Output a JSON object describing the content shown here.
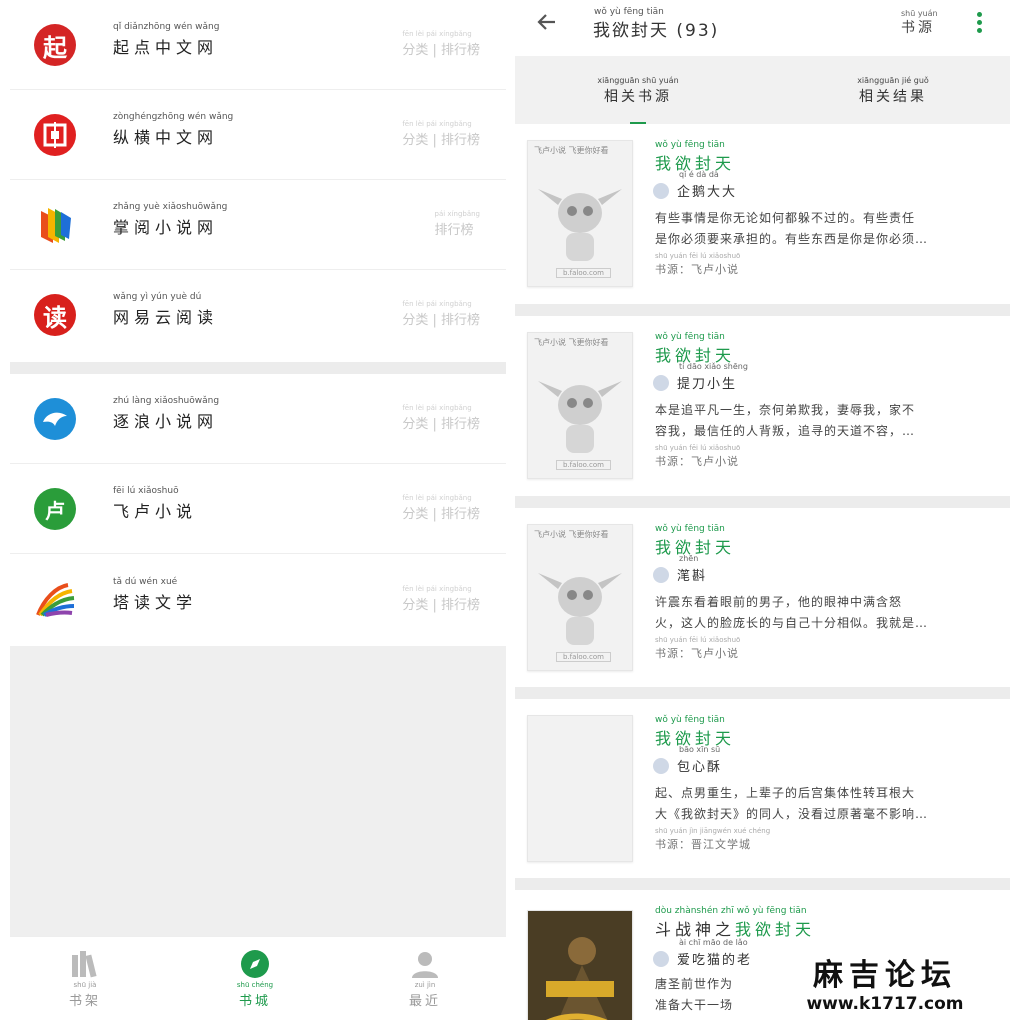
{
  "left_panel": {
    "sources": [
      {
        "pinyin": "qǐ diǎnzhōng wén wǎng",
        "name": "起点中文网",
        "actions_pinyin": "fēn lèi   pái xíngbǎng",
        "actions": "分类 | 排行榜",
        "logo_color": "#d42525",
        "logo_char": "起",
        "icon": "qidian-logo-icon"
      },
      {
        "pinyin": "zònghéngzhōng wén wǎng",
        "name": "纵横中文网",
        "actions_pinyin": "fēn lèi   pái xíngbǎng",
        "actions": "分类 | 排行榜",
        "logo_color": "#e02020",
        "logo_char": "回",
        "icon": "zongheng-logo-icon"
      },
      {
        "pinyin": "zhǎng yuè xiǎoshuōwǎng",
        "name": "掌阅小说网",
        "actions_pinyin": "pái xíngbǎng",
        "actions": "排行榜",
        "logo_color": "#f29a1d",
        "logo_char": "",
        "icon": "zhangyue-logo-icon"
      },
      {
        "pinyin": "wǎng yì yún yuè dú",
        "name": "网易云阅读",
        "actions_pinyin": "fēn lèi   pái xíngbǎng",
        "actions": "分类 | 排行榜",
        "logo_color": "#d8201c",
        "logo_char": "读",
        "icon": "netease-read-logo-icon"
      },
      {
        "pinyin": "zhú làng xiǎoshuōwǎng",
        "name": "逐浪小说网",
        "actions_pinyin": "fēn lèi   pái xíngbǎng",
        "actions": "分类 | 排行榜",
        "logo_color": "#1e8fd8",
        "logo_char": "",
        "icon": "zhulang-dolphin-icon"
      },
      {
        "pinyin": "fēi  lú  xiǎoshuō",
        "name": "飞卢小说",
        "actions_pinyin": "fēn lèi   pái xíngbǎng",
        "actions": "分类 | 排行榜",
        "logo_color": "#2a9d3a",
        "logo_char": "卢",
        "icon": "faloo-logo-icon"
      },
      {
        "pinyin": "tǎ  dú  wén xué",
        "name": "塔读文学",
        "actions_pinyin": "fēn lèi   pái xíngbǎng",
        "actions": "分类 | 排行榜",
        "logo_color": "#f5a623",
        "logo_char": "",
        "icon": "tadu-logo-icon"
      }
    ],
    "nav": [
      {
        "pinyin": "shū jià",
        "label": "书架",
        "icon": "bookshelf-icon"
      },
      {
        "pinyin": "shū chéng",
        "label": "书城",
        "icon": "compass-icon"
      },
      {
        "pinyin": "zuì  jìn",
        "label": "最近",
        "icon": "user-icon"
      }
    ]
  },
  "right_panel": {
    "title_pinyin": "wǒ  yù  fēng tiān",
    "title": "我欲封天 (93)",
    "source_button_pinyin": "shū yuán",
    "source_button": "书源",
    "tabs": [
      {
        "pinyin": "xiāngguān shū yuán",
        "label": "相关书源"
      },
      {
        "pinyin": "xiāngguān  jié  guǒ",
        "label": "相关结果"
      }
    ],
    "cover_text": "飞卢小说 飞更你好看",
    "cover_url": "b.faloo.com",
    "results": [
      {
        "title_prefix": "",
        "title_pinyin": "wǒ  yù  fēng tiān",
        "title": "我欲封天",
        "author_pinyin": "qǐ   é   dà   dà",
        "author": "企鹅大大",
        "desc": [
          "有些事情是你无论如何都躲不过的。有些责任",
          "是你必须要来承担的。有些东西是你是你必须…"
        ],
        "source_pinyin": "shū yuán   fēi  lú  xiǎoshuō",
        "source": "书源：飞卢小说",
        "cover": "faloo"
      },
      {
        "title_prefix": "",
        "title_pinyin": "wǒ  yù  fēng tiān",
        "title": "我欲封天",
        "author_pinyin": "tí  dāo xiǎo shēng",
        "author": "提刀小生",
        "desc": [
          "本是追平凡一生，奈何弟欺我，妻辱我，家不",
          "容我，最信任的人背叛，追寻的天道不容，…"
        ],
        "source_pinyin": "shū yuán   fēi  lú  xiǎoshuō",
        "source": "书源：飞卢小说",
        "cover": "faloo"
      },
      {
        "title_prefix": "",
        "title_pinyin": "wǒ  yù  fēng tiān",
        "title": "我欲封天",
        "author_pinyin": "zhēn",
        "author": "滗斟",
        "desc": [
          "许震东看着眼前的男子，他的眼神中满含怒",
          "火，这人的脸庞长的与自己十分相似。我就是…"
        ],
        "source_pinyin": "shū yuán   fēi  lú  xiǎoshuō",
        "source": "书源：飞卢小说",
        "cover": "faloo"
      },
      {
        "title_prefix": "",
        "title_pinyin": "wǒ  yù  fēng tiān",
        "title": "我欲封天",
        "author_pinyin": "bāo xīn  sū",
        "author": "包心酥",
        "desc": [
          "起、点男重生，上辈子的后宫集体性转耳根大",
          "大《我欲封天》的同人，没看过原著毫不影响…"
        ],
        "source_pinyin": "shū yuán   jìn jiāngwén xué chéng",
        "source": "书源：晋江文学城",
        "cover": "blank"
      },
      {
        "title_prefix": "斗战神之",
        "title_pinyin": "dòu zhànshén zhī  wǒ  yù  fēng tiān",
        "title": "我欲封天",
        "author_pinyin": "ài  chī  māo de lǎo",
        "author": "爱吃猫的老",
        "desc": [
          "唐圣前世作为",
          "准备大干一场"
        ],
        "source_pinyin": "",
        "source": "",
        "cover": "art"
      }
    ]
  },
  "watermark": {
    "line1": "麻吉论坛",
    "line2": "www.k1717.com"
  },
  "colors": {
    "accent": "#1e9a4c",
    "divider": "#ececec"
  }
}
